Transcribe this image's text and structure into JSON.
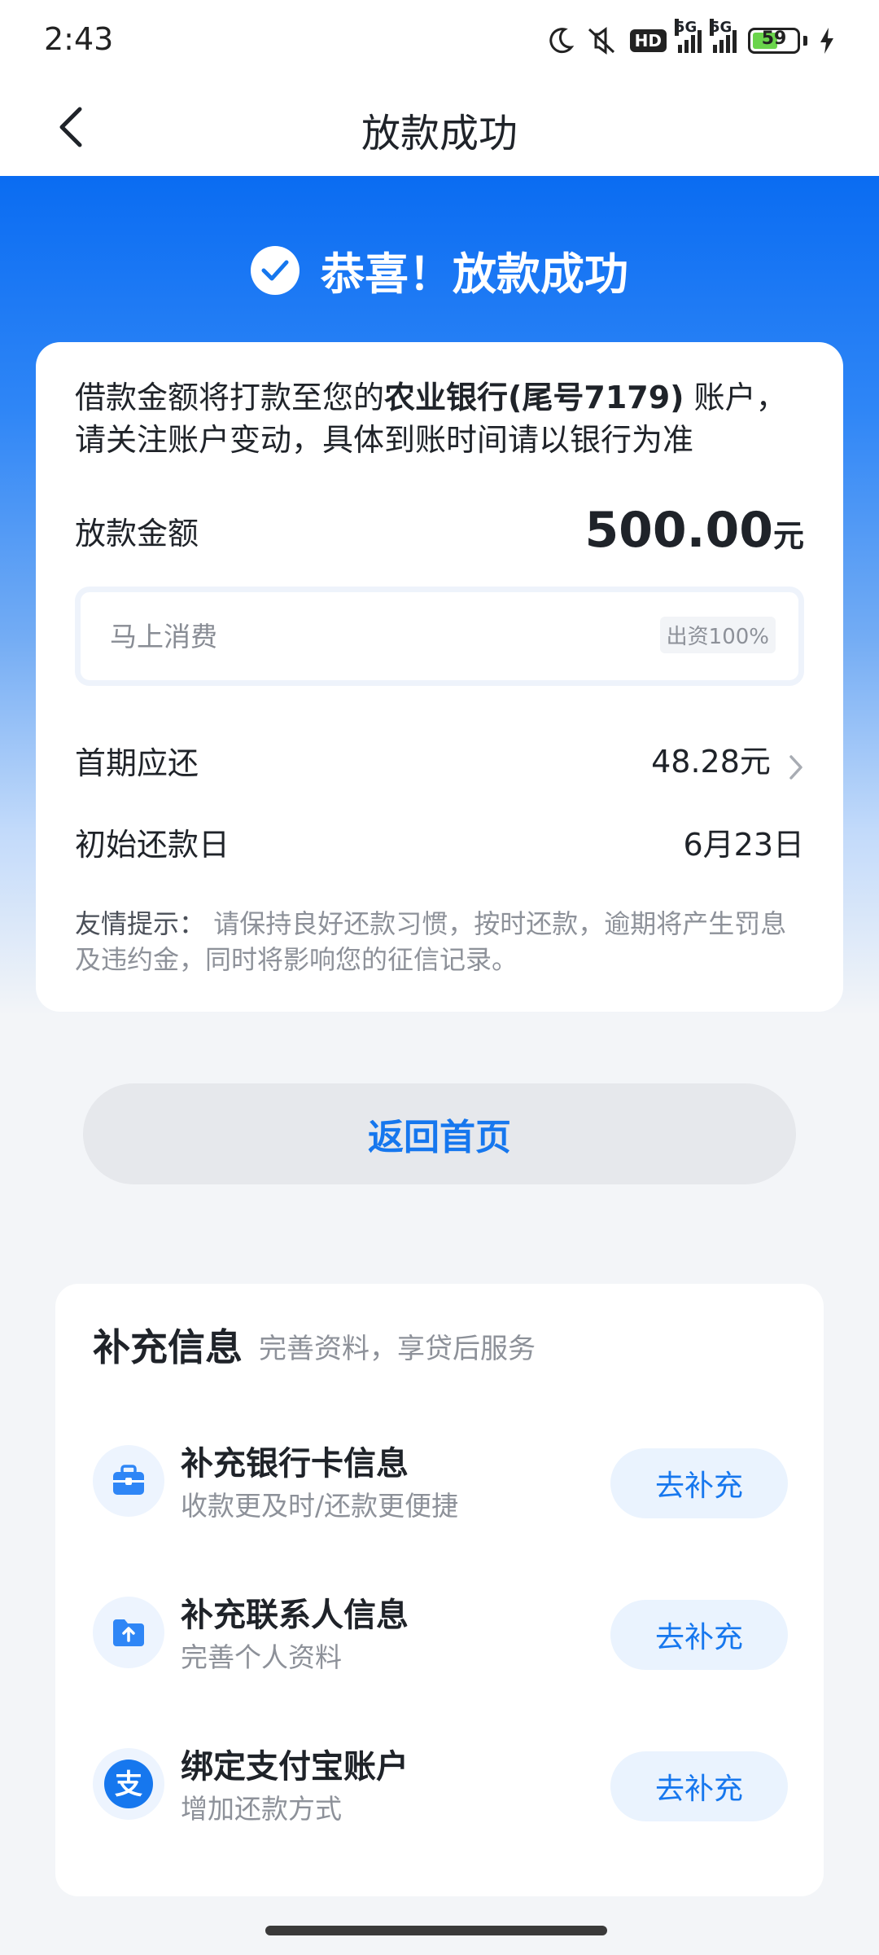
{
  "status_bar": {
    "time": "2:43",
    "battery_level": "59",
    "hd_badge": "HD",
    "network_1": "5G",
    "network_2": "5G",
    "icons": [
      "moon-icon",
      "mute-icon",
      "hd-icon",
      "signal-icon",
      "signal-icon",
      "battery-icon",
      "charging-icon"
    ]
  },
  "nav": {
    "title": "放款成功",
    "back_icon": "chevron-left-icon"
  },
  "hero": {
    "title": "恭喜！放款成功",
    "icon": "check-circle-icon",
    "colors": {
      "primary": "#0a6cf2"
    }
  },
  "summary": {
    "notice_pre": "借款金额将打款至您的",
    "notice_bank": "农业银行(尾号7179)",
    "notice_post": " 账户，请关注账户变动，具体到账时间请以银行为准",
    "amount_label": "放款金额",
    "amount_value": "500.00",
    "amount_unit": "元",
    "lender_name": "马上消费",
    "lender_share": "出资100%",
    "first_repay_label": "首期应还",
    "first_repay_value": "48.28元",
    "start_date_label": "初始还款日",
    "start_date_value": "6月23日",
    "tip_label": "友情提示：",
    "tip_text": " 请保持良好还款习惯，按时还款，逾期将产生罚息及违约金，同时将影响您的征信记录。"
  },
  "actions": {
    "home_button": "返回首页"
  },
  "extra": {
    "title": "补充信息",
    "subtitle": "完善资料，享贷后服务",
    "items": [
      {
        "title": "补充银行卡信息",
        "desc": "收款更及时/还款更便捷",
        "button": "去补充",
        "icon": "briefcase-icon"
      },
      {
        "title": "补充联系人信息",
        "desc": "完善个人资料",
        "button": "去补充",
        "icon": "folder-upload-icon"
      },
      {
        "title": "绑定支付宝账户",
        "desc": "增加还款方式",
        "button": "去补充",
        "icon": "alipay-icon"
      }
    ]
  }
}
